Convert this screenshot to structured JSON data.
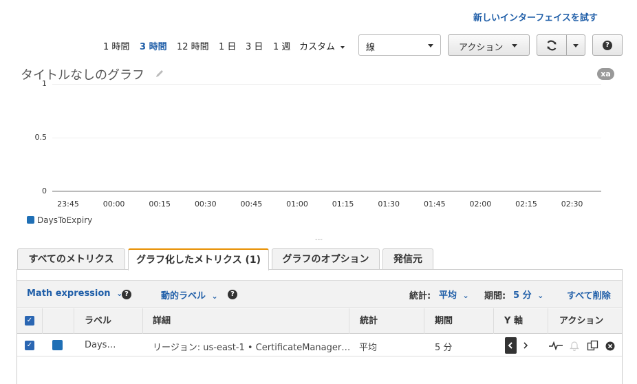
{
  "header": {
    "try_new_interface": "新しいインターフェイスを試す"
  },
  "time_ranges": [
    {
      "label": "1 時間",
      "active": false
    },
    {
      "label": "3 時間",
      "active": true
    },
    {
      "label": "12 時間",
      "active": false
    },
    {
      "label": "1 日",
      "active": false
    },
    {
      "label": "3 日",
      "active": false
    },
    {
      "label": "1 週",
      "active": false
    },
    {
      "label": "カスタム",
      "active": false
    }
  ],
  "chart_type_select": {
    "value": "線"
  },
  "actions_button": {
    "label": "アクション"
  },
  "icons": {
    "refresh": "refresh-icon",
    "dropdown": "chevron-down-icon",
    "help": "help-icon",
    "edit": "pencil-icon"
  },
  "graph": {
    "title": "タイトルなしのグラフ",
    "badge": "xa",
    "legend": [
      {
        "name": "DaysToExpiry",
        "color": "#1f6fb5"
      }
    ]
  },
  "chart_data": {
    "type": "line",
    "title": "タイトルなしのグラフ",
    "x_ticks": [
      "23:45",
      "00:00",
      "00:15",
      "00:30",
      "00:45",
      "01:00",
      "01:15",
      "01:30",
      "01:45",
      "02:00",
      "02:15",
      "02:30"
    ],
    "y_ticks": [
      "0",
      "0.5",
      "1"
    ],
    "ylim": [
      0,
      1
    ],
    "series": [
      {
        "name": "DaysToExpiry",
        "values": []
      }
    ],
    "legend_position": "bottom-left",
    "grid": true
  },
  "tabs": [
    {
      "label": "すべてのメトリクス",
      "active": false
    },
    {
      "label": "グラフ化したメトリクス (1)",
      "active": true
    },
    {
      "label": "グラフのオプション",
      "active": false
    },
    {
      "label": "発信元",
      "active": false
    }
  ],
  "toolbar": {
    "math_expression": "Math expression",
    "dynamic_label": "動的ラベル",
    "stat_label": "統計:",
    "stat_value": "平均",
    "period_label": "期間:",
    "period_value": "5 分",
    "delete_all": "すべて削除",
    "help_glyph": "?"
  },
  "table": {
    "columns": [
      "ラベル",
      "詳細",
      "統計",
      "期間",
      "Y 軸",
      "アクション"
    ],
    "rows": [
      {
        "label": "Days…",
        "details": "リージョン: us-east-1 • CertificateManager…",
        "stat": "平均",
        "period": "5 分",
        "color": "#1f6fb5",
        "checked": true
      }
    ]
  }
}
